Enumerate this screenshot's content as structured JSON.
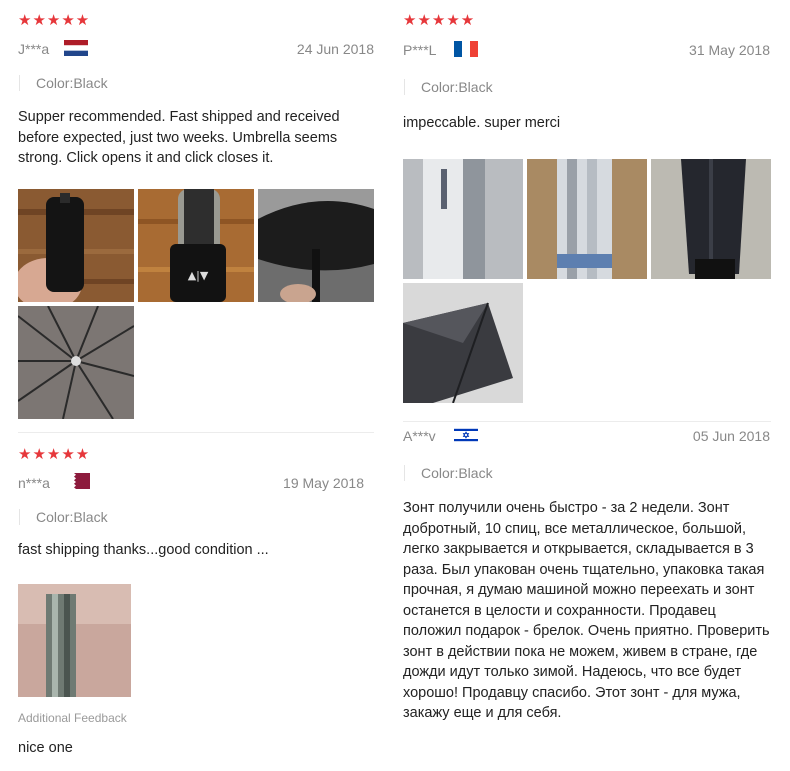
{
  "reviews": [
    {
      "rating": "★★★★★",
      "reviewer": "J***a",
      "country_flag": "netherlands-flag",
      "date": "24 Jun 2018",
      "color": "Color:Black",
      "text": "Supper recommended. Fast shipped and received before expected, just two weeks. Umbrella seems strong. Click opens it and click closes it."
    },
    {
      "rating": "★★★★★",
      "reviewer": "n***a",
      "country_flag": "qatar-flag",
      "date": "19 May 2018",
      "color": "Color:Black",
      "text": "fast shipping  thanks...good condition ...",
      "additional_label": "Additional Feedback",
      "additional_text": "nice one"
    },
    {
      "rating": "★★★★★",
      "reviewer": "P***L",
      "country_flag": "france-flag",
      "date": "31 May 2018",
      "color": "Color:Black",
      "text": "impeccable. super merci"
    },
    {
      "reviewer": "A***v",
      "country_flag": "israel-flag",
      "date": "05 Jun 2018",
      "color": "Color:Black",
      "text": "Зонт получили очень быстро - за 2  недели. Зонт добротный, 10 спиц, все металлическое, большой, легко закрывается и открывается, складывается в 3 раза. Был упакован очень тщательно, упаковка такая прочная, я думаю машиной можно переехать и зонт останется в целости и сохранности. Продавец положил подарок - брелок. Очень приятно. Проверить зонт в действии пока не можем, живем в стране, где дожди  идут только зимой. Надеюсь, что все будет хорошо! Продавцу спасибо. Этот зонт - для мужа, закажу еще и для себя."
    }
  ],
  "colors": {
    "star": "#e6373b",
    "muted_text": "#888888",
    "body_text": "#222222"
  }
}
